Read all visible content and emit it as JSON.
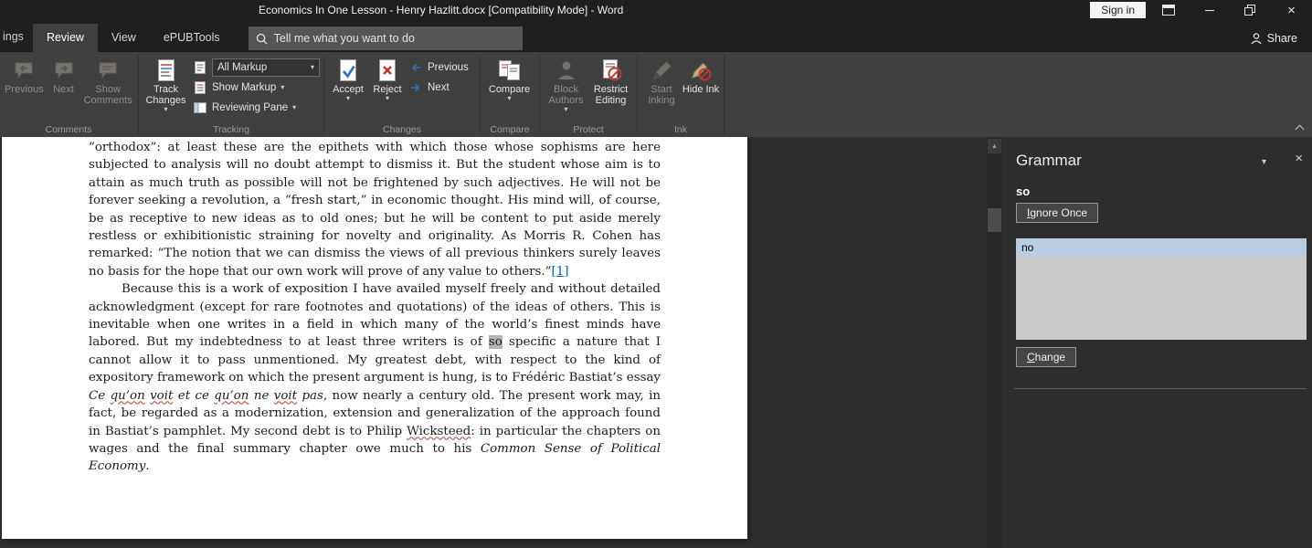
{
  "icons": {
    "chevron_down": "▾",
    "close": "×",
    "scroll_up_arrow": "▲"
  },
  "titlebar": {
    "title": "Economics In One Lesson - Henry Hazlitt.docx [Compatibility Mode]  -  Word",
    "sign_in_label": "Sign in"
  },
  "tab_bar": {
    "partial_tab": "ings",
    "tabs": [
      {
        "label": "Review"
      },
      {
        "label": "View"
      },
      {
        "label": "ePUBTools"
      }
    ],
    "tell_me_placeholder": "Tell me what you want to do",
    "share_label": "Share"
  },
  "ribbon": {
    "comments": {
      "previous": "Previous",
      "next": "Next",
      "show_comments": "Show Comments",
      "label": "Comments"
    },
    "tracking": {
      "track_changes": "Track Changes",
      "all_markup": "All Markup",
      "show_markup": "Show Markup",
      "reviewing_pane": "Reviewing Pane",
      "label": "Tracking"
    },
    "changes": {
      "accept": "Accept",
      "reject": "Reject",
      "previous": "Previous",
      "next": "Next",
      "label": "Changes"
    },
    "compare": {
      "compare": "Compare",
      "label": "Compare"
    },
    "protect": {
      "block_authors": "Block Authors",
      "restrict_editing": "Restrict Editing",
      "label": "Protect"
    },
    "ink": {
      "start_inking": "Start Inking",
      "hide_ink": "Hide Ink",
      "label": "Ink"
    }
  },
  "document": {
    "paragraphs": [
      {
        "indent": false,
        "runs": [
          {
            "text": "“orthodox”: at least these are the epithets with which those whose sophisms are here subjected to analysis will no doubt attempt to dismiss it. But the student whose aim is to attain as much truth as possible will not be frightened by such adjectives. He will not be forever seeking a revolution, a “fresh start,” in economic thought. His mind will, of course, be as receptive to new ideas as to old ones; but he will be content to put aside merely restless or exhibitionistic straining for novelty and originality. As Morris R. Cohen has remarked: “The notion that we can dismiss the views of all previous thinkers surely leaves no basis for the hope that our own work will prove of any value to others.”"
          },
          {
            "text": "[1]",
            "style": "link"
          }
        ]
      },
      {
        "indent": true,
        "runs": [
          {
            "text": "Because this is a work of exposition I have availed myself freely and without detailed acknowledgment (except for rare footnotes and quotations) of the ideas of others. This is inevitable when one writes in a field in which many of the world’s finest minds have labored. But my indebtedness to at least three writers is of "
          },
          {
            "text": "so",
            "style": "highlight"
          },
          {
            "text": " specific a nature that I cannot allow it to pass unmentioned. My greatest debt, with respect to the kind of expository framework on which the present argument is hung, is to Frédéric Bastiat’s essay "
          },
          {
            "text": "Ce ",
            "style": "italic"
          },
          {
            "text": "qu’on",
            "style": "italic squiggly"
          },
          {
            "text": " ",
            "style": "italic"
          },
          {
            "text": "voit",
            "style": "italic squiggly"
          },
          {
            "text": " et ce ",
            "style": "italic"
          },
          {
            "text": "qu’on",
            "style": "italic squiggly"
          },
          {
            "text": " ne ",
            "style": "italic"
          },
          {
            "text": "voit",
            "style": "italic squiggly"
          },
          {
            "text": " pas",
            "style": "italic"
          },
          {
            "text": ", now nearly a century old. The present work may, in fact, be regarded as a modernization, extension and generalization of the approach found in Bastiat’s pamphlet. My second debt is to Philip "
          },
          {
            "text": "Wicksteed",
            "style": "squiggly"
          },
          {
            "text": ": in particular the chapters on wages and the final summary chapter owe much to his "
          },
          {
            "text": "Common Sense of Political Economy",
            "style": "italic"
          },
          {
            "text": ".",
            "style": ""
          }
        ]
      }
    ]
  },
  "grammar_pane": {
    "title": "Grammar",
    "flagged_word": "so",
    "ignore_button": {
      "accel": "I",
      "rest": "gnore Once"
    },
    "suggestions": [
      "no"
    ],
    "change_button": {
      "accel": "C",
      "rest": "hange"
    }
  }
}
